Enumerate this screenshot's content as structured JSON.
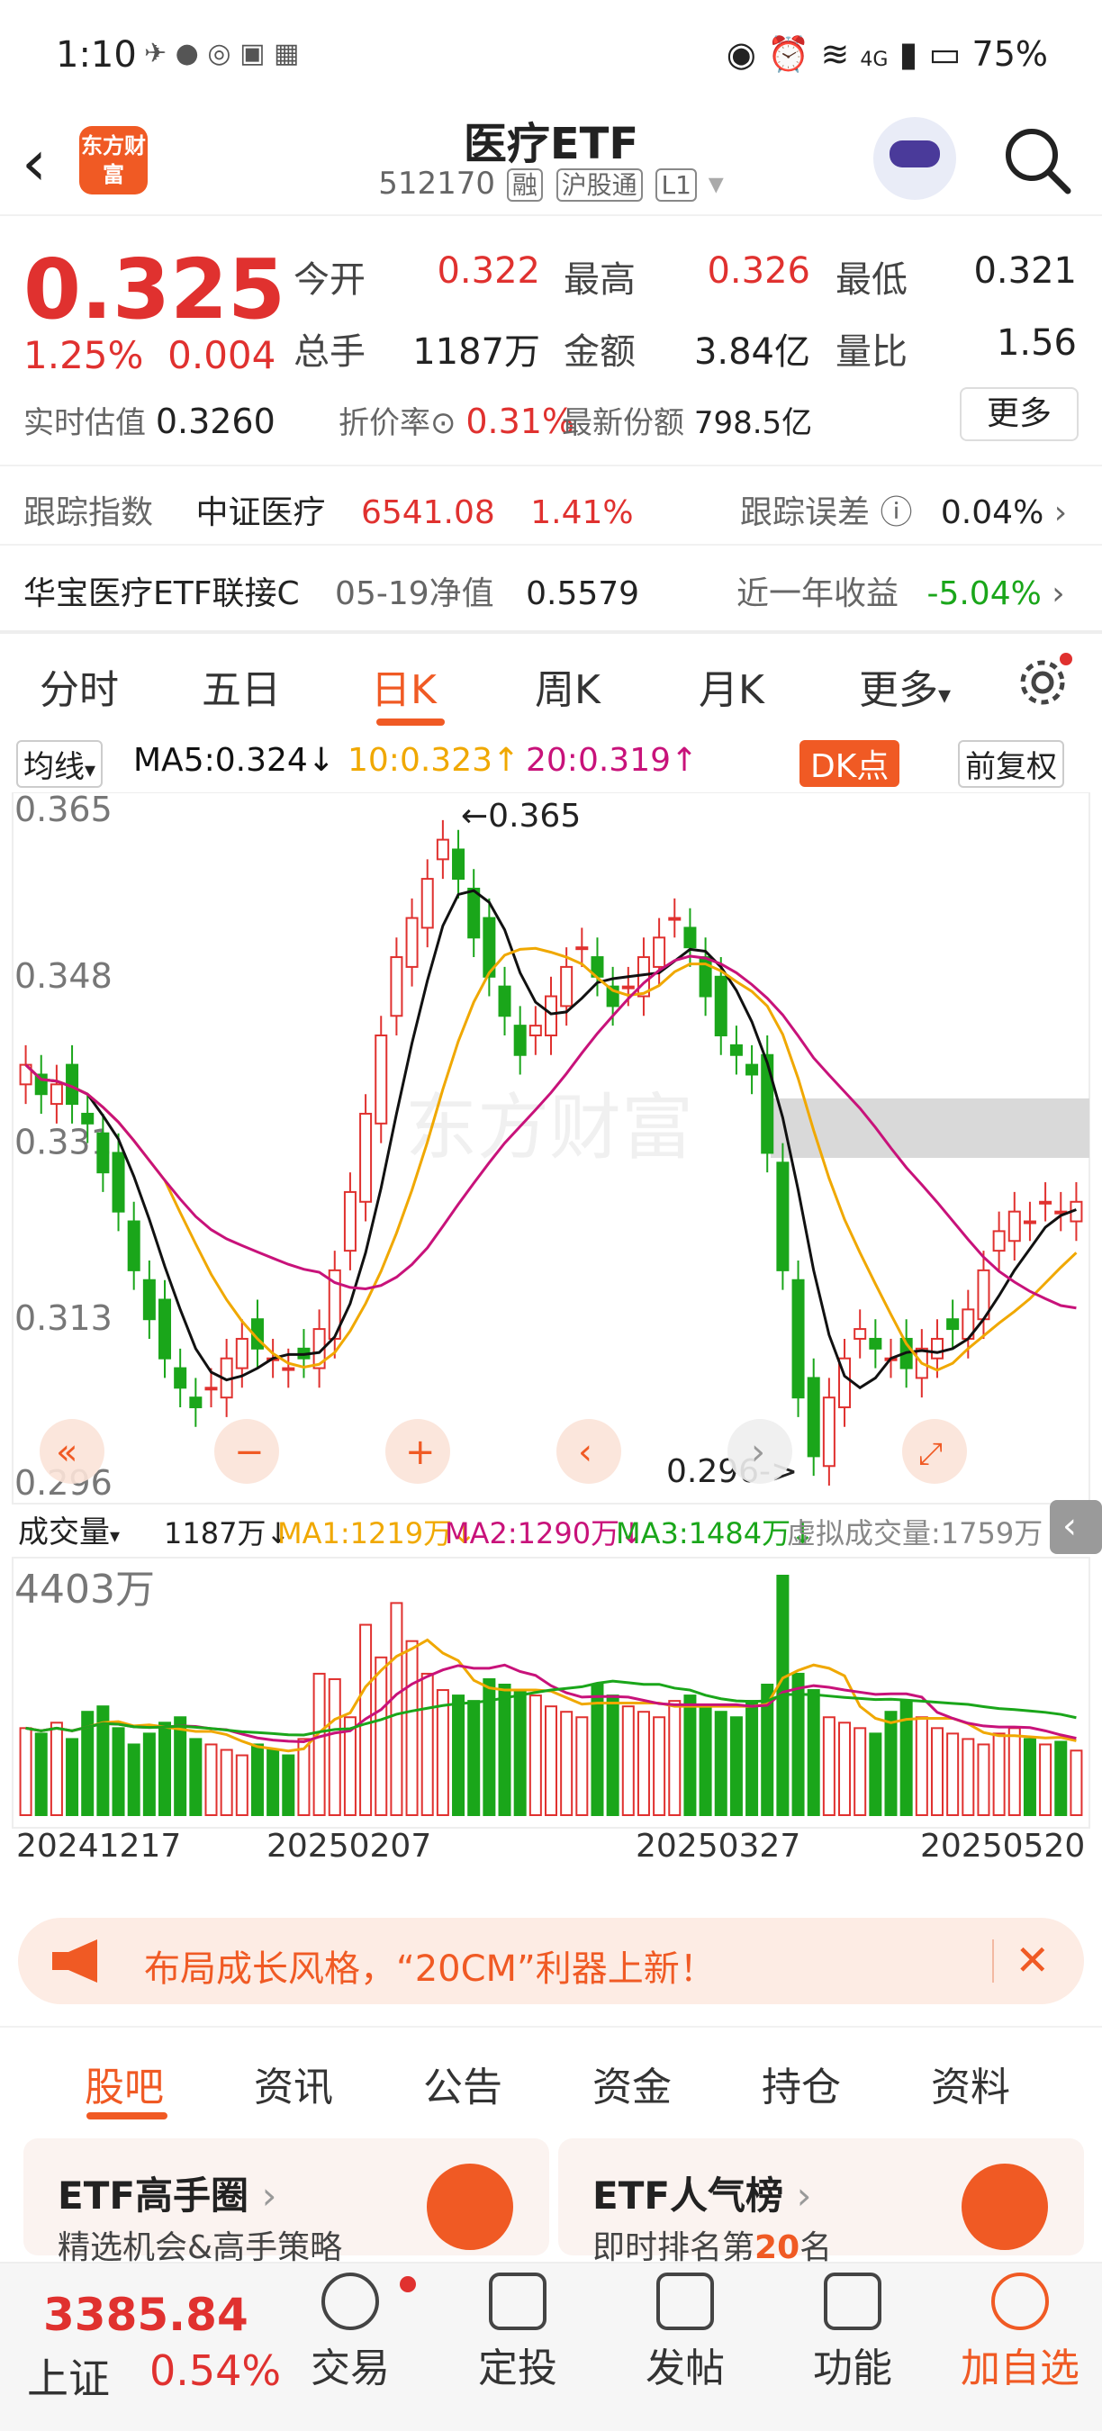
{
  "status_bar": {
    "time": "1:10",
    "signal": "4G",
    "battery": "75%"
  },
  "header": {
    "title": "医疗ETF",
    "code": "512170",
    "tags": [
      "融",
      "沪股通",
      "L1"
    ],
    "logo_text": "东方财富"
  },
  "quote": {
    "price": "0.325",
    "change_pct": "1.25%",
    "change": "0.004",
    "stats": [
      {
        "label": "今开",
        "value": "0.322"
      },
      {
        "label": "最高",
        "value": "0.326"
      },
      {
        "label": "最低",
        "value": "0.321"
      },
      {
        "label": "总手",
        "value": "1187万"
      },
      {
        "label": "金额",
        "value": "3.84亿"
      },
      {
        "label": "量比",
        "value": "1.56"
      }
    ],
    "realtime_est_label": "实时估值",
    "realtime_est": "0.3260",
    "premium_label": "折价率",
    "premium": "0.31%",
    "shares_label": "最新份额",
    "shares": "798.5亿",
    "more": "更多",
    "track_index_label": "跟踪指数",
    "track_index_name": "中证医疗",
    "track_index_value": "6541.08",
    "track_index_pct": "1.41%",
    "track_error_label": "跟踪误差",
    "track_error": "0.04%",
    "linked_fund": "华宝医疗ETF联接C",
    "nav_label": "05-19净值",
    "nav": "0.5579",
    "year_return_label": "近一年收益",
    "year_return": "-5.04%"
  },
  "ktabs": [
    "分时",
    "五日",
    "日K",
    "周K",
    "月K",
    "更多"
  ],
  "ma_row": {
    "selector": "均线",
    "ma5": "MA5:0.324↓",
    "ma10": "10:0.323↑",
    "ma20": "20:0.319↑",
    "dk": "DK点",
    "adjust": "前复权"
  },
  "chart_labels": {
    "high_marker": "←0.365",
    "low_marker": "0.296->",
    "watermark": "东方财富"
  },
  "volume_row": {
    "selector": "成交量",
    "vol": "1187万↓",
    "ma1": "MA1:1219万↓",
    "ma2": "MA2:1290万↓",
    "ma3": "MA3:1484万↓",
    "virtual": "虚拟成交量:1759万"
  },
  "dates": [
    "20241217",
    "20250207",
    "20250327",
    "20250520"
  ],
  "chart_data": {
    "type": "candlestick",
    "ylim": [
      0.296,
      0.365
    ],
    "yticks": [
      "0.365",
      "0.348",
      "0.331",
      "0.313",
      "0.296"
    ],
    "vol_max_label": "4403万",
    "closes": [
      0.339,
      0.336,
      0.337,
      0.335,
      0.333,
      0.328,
      0.324,
      0.318,
      0.313,
      0.309,
      0.306,
      0.304,
      0.306,
      0.309,
      0.311,
      0.31,
      0.309,
      0.308,
      0.309,
      0.312,
      0.318,
      0.326,
      0.334,
      0.342,
      0.35,
      0.354,
      0.358,
      0.362,
      0.358,
      0.352,
      0.348,
      0.344,
      0.34,
      0.343,
      0.346,
      0.349,
      0.351,
      0.348,
      0.345,
      0.347,
      0.35,
      0.352,
      0.354,
      0.351,
      0.346,
      0.342,
      0.34,
      0.338,
      0.33,
      0.318,
      0.305,
      0.299,
      0.305,
      0.309,
      0.312,
      0.31,
      0.309,
      0.308,
      0.31,
      0.311,
      0.312,
      0.314,
      0.318,
      0.322,
      0.324,
      0.323,
      0.325,
      0.324,
      0.325
    ],
    "volumes": [
      1600,
      1500,
      1700,
      1400,
      1900,
      2000,
      1600,
      1300,
      1500,
      1700,
      1800,
      1400,
      1300,
      1200,
      1100,
      1300,
      1200,
      1100,
      1400,
      2600,
      2500,
      1800,
      3500,
      2900,
      3900,
      3200,
      2600,
      2300,
      2200,
      2100,
      2500,
      2400,
      2300,
      2200,
      2000,
      1900,
      1800,
      2400,
      2200,
      2000,
      1900,
      1800,
      2100,
      2200,
      2000,
      1900,
      1800,
      2100,
      2400,
      4403,
      2600,
      2300,
      1800,
      1700,
      1600,
      1500,
      1900,
      2100,
      1800,
      1600,
      1500,
      1400,
      1300,
      1500,
      1600,
      1400,
      1300,
      1350,
      1187
    ]
  },
  "banner": {
    "text": "布局成长风格，“20CM”利器上新！"
  },
  "btabs": [
    "股吧",
    "资讯",
    "公告",
    "资金",
    "持仓",
    "资料"
  ],
  "cards": [
    {
      "title": "ETF高手圈",
      "sub": "精选机会&高手策略"
    },
    {
      "title": "ETF人气榜",
      "sub_prefix": "即时排名第",
      "rank": "20",
      "sub_suffix": "名"
    }
  ],
  "bottombar": {
    "index_value": "3385.84",
    "index_name": "上证",
    "index_pct": "0.54%",
    "items": [
      "交易",
      "定投",
      "发帖",
      "功能",
      "加自选"
    ]
  },
  "colors": {
    "accent": "#f05a24",
    "up": "#e0312f",
    "down": "#1aa61a",
    "ma5": "#111111",
    "ma10": "#f0a800",
    "ma20": "#c8127a"
  }
}
